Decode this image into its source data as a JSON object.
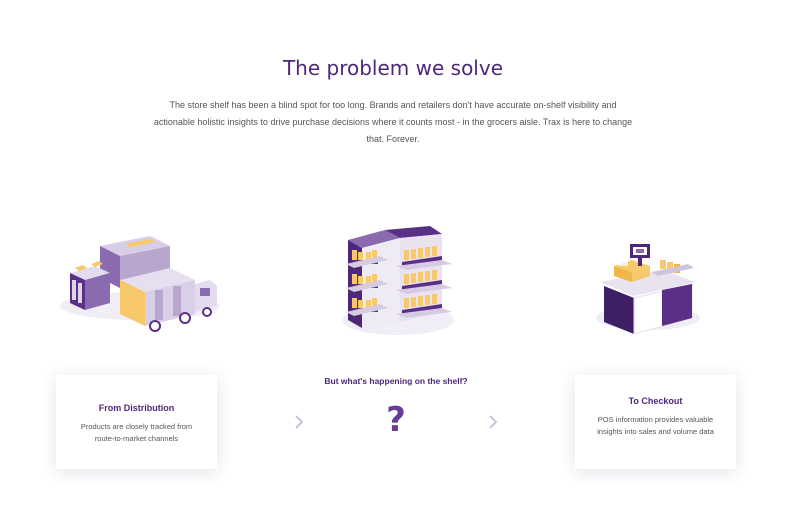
{
  "heading": "The problem we solve",
  "intro": "The store shelf has been a blind spot for too long. Brands and retailers don't have accurate on-shelf visibility and actionable holistic insights to drive purchase decisions where it counts most - in the grocers aisle. Trax is here to change that. Forever.",
  "left_card": {
    "title": "From Distribution",
    "text": "Products are closely tracked from route-to-market channels"
  },
  "middle": {
    "label": "But what's happening on the shelf?",
    "symbol": "?"
  },
  "right_card": {
    "title": "To Checkout",
    "text": "POS information provides valuable insights into sales and volume data"
  },
  "icons": {
    "left": "distribution-trucks-icon",
    "middle": "store-shelf-icon",
    "right": "checkout-counter-icon",
    "arrow": "chevron-right-icon"
  },
  "colors": {
    "accent": "#4f2778",
    "purple_light": "#b8a6cf",
    "yellow": "#f7c96a",
    "chevron": "#c9b7dc"
  }
}
